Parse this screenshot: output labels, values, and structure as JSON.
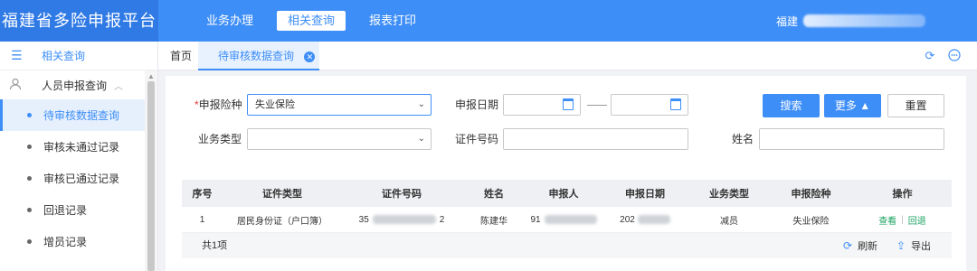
{
  "app": {
    "title": "福建省多险申报平台"
  },
  "topnav": {
    "items": [
      {
        "label": "业务办理"
      },
      {
        "label": "相关查询"
      },
      {
        "label": "报表打印"
      }
    ],
    "user_prefix": "福建"
  },
  "sidebar": {
    "header": "相关查询",
    "group": "人员申报查询",
    "items": [
      {
        "label": "待审核数据查询"
      },
      {
        "label": "审核未通过记录"
      },
      {
        "label": "审核已通过记录"
      },
      {
        "label": "回退记录"
      },
      {
        "label": "增员记录"
      }
    ]
  },
  "tabs": {
    "home": "首页",
    "active": "待审核数据查询"
  },
  "form": {
    "insurance_label": "申报险种",
    "insurance_value": "失业保险",
    "date_label": "申报日期",
    "business_type_label": "业务类型",
    "cert_no_label": "证件号码",
    "name_label": "姓名",
    "search_button": "搜索",
    "more_button": "更多 ▲",
    "reset_button": "重置"
  },
  "table": {
    "columns": [
      "序号",
      "证件类型",
      "证件号码",
      "姓名",
      "申报人",
      "申报日期",
      "业务类型",
      "申报险种",
      "操作"
    ],
    "rows": [
      {
        "index": "1",
        "cert_type": "居民身份证（户口簿）",
        "cert_no_start": "35",
        "cert_no_end": "2",
        "name": "陈建华",
        "declarant_start": "91",
        "date_start": "202",
        "business_type": "减员",
        "insurance": "失业保险",
        "action_view": "查看",
        "action_return": "回退"
      }
    ],
    "total": "共1项",
    "refresh": "刷新",
    "export": "导出"
  },
  "colors": {
    "primary": "#3e8ef7",
    "action_link": "#1aa260",
    "required": "#e4393c"
  }
}
